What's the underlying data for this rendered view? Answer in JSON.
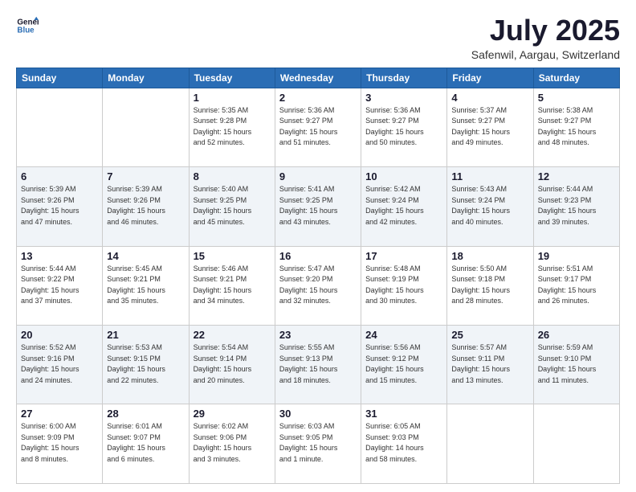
{
  "header": {
    "logo": {
      "line1": "General",
      "line2": "Blue"
    },
    "title": "July 2025",
    "location": "Safenwil, Aargau, Switzerland"
  },
  "weekdays": [
    "Sunday",
    "Monday",
    "Tuesday",
    "Wednesday",
    "Thursday",
    "Friday",
    "Saturday"
  ],
  "weeks": [
    [
      {
        "day": "",
        "info": ""
      },
      {
        "day": "",
        "info": ""
      },
      {
        "day": "1",
        "info": "Sunrise: 5:35 AM\nSunset: 9:28 PM\nDaylight: 15 hours\nand 52 minutes."
      },
      {
        "day": "2",
        "info": "Sunrise: 5:36 AM\nSunset: 9:27 PM\nDaylight: 15 hours\nand 51 minutes."
      },
      {
        "day": "3",
        "info": "Sunrise: 5:36 AM\nSunset: 9:27 PM\nDaylight: 15 hours\nand 50 minutes."
      },
      {
        "day": "4",
        "info": "Sunrise: 5:37 AM\nSunset: 9:27 PM\nDaylight: 15 hours\nand 49 minutes."
      },
      {
        "day": "5",
        "info": "Sunrise: 5:38 AM\nSunset: 9:27 PM\nDaylight: 15 hours\nand 48 minutes."
      }
    ],
    [
      {
        "day": "6",
        "info": "Sunrise: 5:39 AM\nSunset: 9:26 PM\nDaylight: 15 hours\nand 47 minutes."
      },
      {
        "day": "7",
        "info": "Sunrise: 5:39 AM\nSunset: 9:26 PM\nDaylight: 15 hours\nand 46 minutes."
      },
      {
        "day": "8",
        "info": "Sunrise: 5:40 AM\nSunset: 9:25 PM\nDaylight: 15 hours\nand 45 minutes."
      },
      {
        "day": "9",
        "info": "Sunrise: 5:41 AM\nSunset: 9:25 PM\nDaylight: 15 hours\nand 43 minutes."
      },
      {
        "day": "10",
        "info": "Sunrise: 5:42 AM\nSunset: 9:24 PM\nDaylight: 15 hours\nand 42 minutes."
      },
      {
        "day": "11",
        "info": "Sunrise: 5:43 AM\nSunset: 9:24 PM\nDaylight: 15 hours\nand 40 minutes."
      },
      {
        "day": "12",
        "info": "Sunrise: 5:44 AM\nSunset: 9:23 PM\nDaylight: 15 hours\nand 39 minutes."
      }
    ],
    [
      {
        "day": "13",
        "info": "Sunrise: 5:44 AM\nSunset: 9:22 PM\nDaylight: 15 hours\nand 37 minutes."
      },
      {
        "day": "14",
        "info": "Sunrise: 5:45 AM\nSunset: 9:21 PM\nDaylight: 15 hours\nand 35 minutes."
      },
      {
        "day": "15",
        "info": "Sunrise: 5:46 AM\nSunset: 9:21 PM\nDaylight: 15 hours\nand 34 minutes."
      },
      {
        "day": "16",
        "info": "Sunrise: 5:47 AM\nSunset: 9:20 PM\nDaylight: 15 hours\nand 32 minutes."
      },
      {
        "day": "17",
        "info": "Sunrise: 5:48 AM\nSunset: 9:19 PM\nDaylight: 15 hours\nand 30 minutes."
      },
      {
        "day": "18",
        "info": "Sunrise: 5:50 AM\nSunset: 9:18 PM\nDaylight: 15 hours\nand 28 minutes."
      },
      {
        "day": "19",
        "info": "Sunrise: 5:51 AM\nSunset: 9:17 PM\nDaylight: 15 hours\nand 26 minutes."
      }
    ],
    [
      {
        "day": "20",
        "info": "Sunrise: 5:52 AM\nSunset: 9:16 PM\nDaylight: 15 hours\nand 24 minutes."
      },
      {
        "day": "21",
        "info": "Sunrise: 5:53 AM\nSunset: 9:15 PM\nDaylight: 15 hours\nand 22 minutes."
      },
      {
        "day": "22",
        "info": "Sunrise: 5:54 AM\nSunset: 9:14 PM\nDaylight: 15 hours\nand 20 minutes."
      },
      {
        "day": "23",
        "info": "Sunrise: 5:55 AM\nSunset: 9:13 PM\nDaylight: 15 hours\nand 18 minutes."
      },
      {
        "day": "24",
        "info": "Sunrise: 5:56 AM\nSunset: 9:12 PM\nDaylight: 15 hours\nand 15 minutes."
      },
      {
        "day": "25",
        "info": "Sunrise: 5:57 AM\nSunset: 9:11 PM\nDaylight: 15 hours\nand 13 minutes."
      },
      {
        "day": "26",
        "info": "Sunrise: 5:59 AM\nSunset: 9:10 PM\nDaylight: 15 hours\nand 11 minutes."
      }
    ],
    [
      {
        "day": "27",
        "info": "Sunrise: 6:00 AM\nSunset: 9:09 PM\nDaylight: 15 hours\nand 8 minutes."
      },
      {
        "day": "28",
        "info": "Sunrise: 6:01 AM\nSunset: 9:07 PM\nDaylight: 15 hours\nand 6 minutes."
      },
      {
        "day": "29",
        "info": "Sunrise: 6:02 AM\nSunset: 9:06 PM\nDaylight: 15 hours\nand 3 minutes."
      },
      {
        "day": "30",
        "info": "Sunrise: 6:03 AM\nSunset: 9:05 PM\nDaylight: 15 hours\nand 1 minute."
      },
      {
        "day": "31",
        "info": "Sunrise: 6:05 AM\nSunset: 9:03 PM\nDaylight: 14 hours\nand 58 minutes."
      },
      {
        "day": "",
        "info": ""
      },
      {
        "day": "",
        "info": ""
      }
    ]
  ]
}
